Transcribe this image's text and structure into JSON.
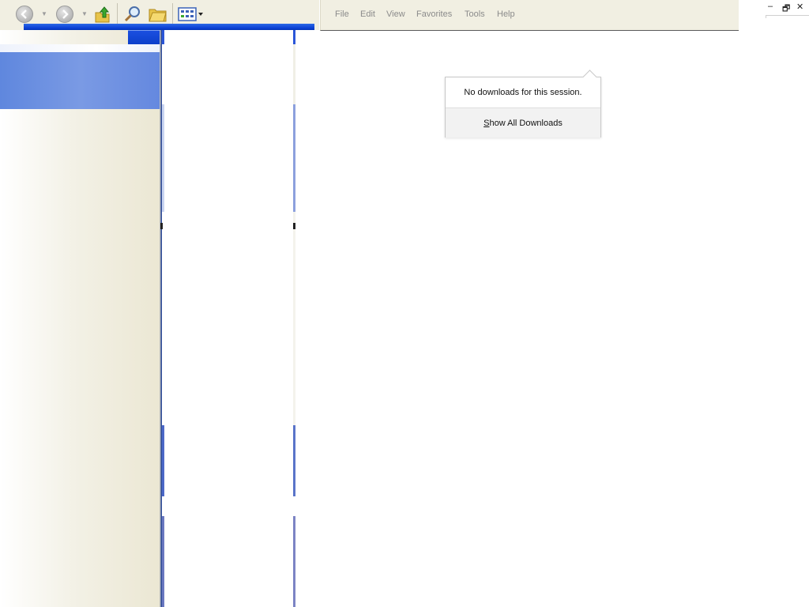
{
  "toolbar": {
    "buttons": [
      "back-arrow-icon",
      "forward-arrow-icon",
      "folder-up-icon",
      "search-icon",
      "folders-icon",
      "views-icon"
    ],
    "colors": {
      "accent_blue": "#0a3fd4",
      "up_green": "#3aa82e",
      "folder_yellow": "#e8c44a"
    }
  },
  "menubar": {
    "items": [
      "File",
      "Edit",
      "View",
      "Favorites",
      "Tools",
      "Help"
    ]
  },
  "window_controls": {
    "minimize_glyph": "–",
    "restore_glyph": "🗗",
    "close_glyph": "✕"
  },
  "downloads_panel": {
    "empty_message": "No downloads for this session.",
    "show_all_prefix": "",
    "show_all_accesskey": "S",
    "show_all_rest": "how All Downloads"
  }
}
